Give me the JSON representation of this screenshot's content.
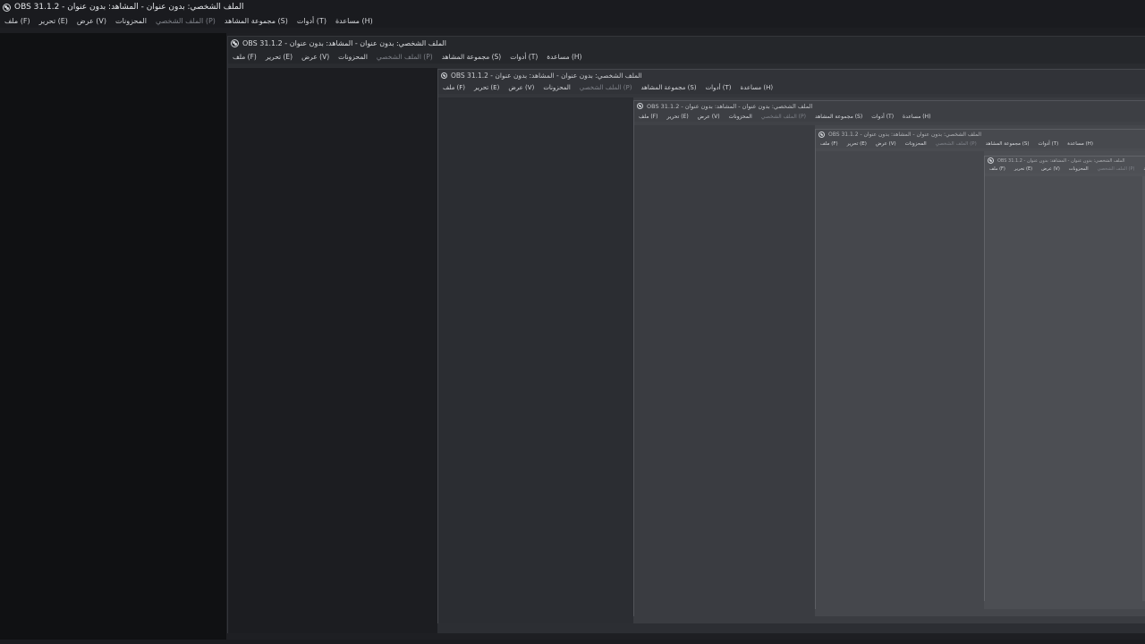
{
  "window": {
    "title": "OBS 31.1.2 - الملف الشخصي: بدون عنوان - المشاهد: بدون عنوان"
  },
  "menu": {
    "items": [
      {
        "label": "ملف (F)",
        "enabled": true
      },
      {
        "label": "تحرير (E)",
        "enabled": true
      },
      {
        "label": "عرض (V)",
        "enabled": true
      },
      {
        "label": "المحزونات",
        "enabled": true
      },
      {
        "label": "الملف الشخصي (P)",
        "enabled": false
      },
      {
        "label": "مجموعة المشاهد (S)",
        "enabled": true
      },
      {
        "label": "أدوات (T)",
        "enabled": true
      },
      {
        "label": "مساعدة (H)",
        "enabled": true
      }
    ]
  },
  "theme": {
    "background": "#111214",
    "menubar": "#1a1b1f",
    "text": "#d4d6da",
    "disabled_text": "#7e8188"
  },
  "icons": {
    "app": "obs-logo-icon"
  }
}
